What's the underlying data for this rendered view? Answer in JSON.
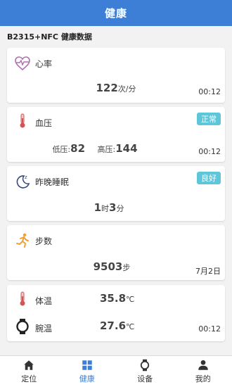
{
  "header": {
    "title": "健康"
  },
  "section_title": "B2315+NFC 健康数据",
  "heart": {
    "label": "心率",
    "value": "122",
    "unit": "次/分",
    "time": "00:12"
  },
  "blood_pressure": {
    "label": "血压",
    "badge": "正常",
    "low_label": "低压:",
    "low_value": "82",
    "high_label": "高压:",
    "high_value": "144",
    "time": "00:12"
  },
  "sleep": {
    "label": "昨晚睡眠",
    "badge": "良好",
    "hours": "1",
    "hours_unit": "时",
    "minutes": "3",
    "minutes_unit": "分"
  },
  "steps": {
    "label": "步数",
    "value": "9503",
    "unit": "步",
    "date": "7月2日"
  },
  "temperature": {
    "body_label": "体温",
    "body_value": "35.8",
    "body_unit": "℃",
    "wrist_label": "腕温",
    "wrist_value": "27.6",
    "wrist_unit": "℃",
    "time": "00:12"
  },
  "nav": {
    "items": [
      {
        "label": "定位",
        "icon": "home-icon"
      },
      {
        "label": "健康",
        "icon": "grid-icon"
      },
      {
        "label": "设备",
        "icon": "watch-icon"
      },
      {
        "label": "我的",
        "icon": "user-icon"
      }
    ],
    "active_index": 1
  },
  "colors": {
    "primary": "#3d7fd6",
    "badge": "#5ec6d9"
  }
}
